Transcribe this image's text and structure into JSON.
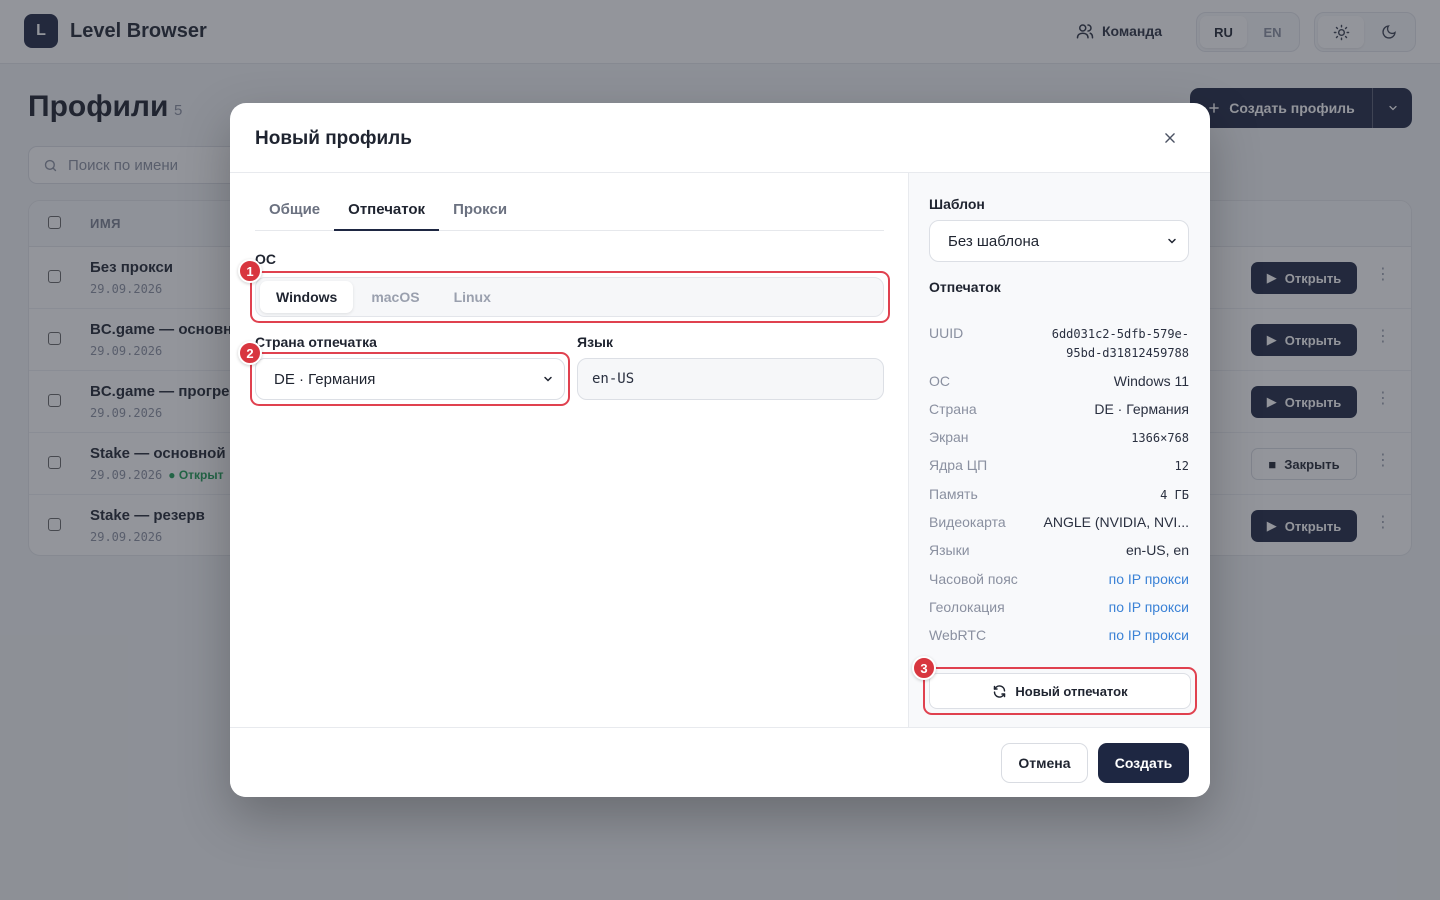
{
  "app": {
    "logo_letter": "L",
    "name": "Level Browser"
  },
  "header": {
    "team_label": "Команда",
    "languages": [
      "RU",
      "EN"
    ],
    "active_language": "RU"
  },
  "page": {
    "title": "Профили",
    "count": "5",
    "create_label": "Создать профиль",
    "search_placeholder": "Поиск по имени",
    "column_name": "ИМЯ"
  },
  "profiles": [
    {
      "name": "Без прокси",
      "date": "29.09.2026",
      "status": "",
      "action": "Открыть"
    },
    {
      "name": "BC.game — основной",
      "date": "29.09.2026",
      "status": "",
      "action": "Открыть"
    },
    {
      "name": "BC.game — прогрев",
      "date": "29.09.2026",
      "status": "",
      "action": "Открыть"
    },
    {
      "name": "Stake — основной",
      "date": "29.09.2026",
      "status": "● Открыт",
      "action": "Закрыть"
    },
    {
      "name": "Stake — резерв",
      "date": "29.09.2026",
      "status": "",
      "action": "Открыть"
    }
  ],
  "modal": {
    "title": "Новый профиль",
    "tabs": [
      "Общие",
      "Отпечаток",
      "Прокси"
    ],
    "active_tab": "Отпечаток",
    "os_label": "ОС",
    "os_options": [
      "Windows",
      "macOS",
      "Linux"
    ],
    "os_selected": "Windows",
    "country_label": "Страна отпечатка",
    "country_value": "DE · Германия",
    "language_label": "Язык",
    "language_value": "en-US",
    "template_label": "Шаблон",
    "template_value": "Без шаблона",
    "fingerprint_label": "Отпечаток",
    "fingerprint": {
      "uuid_key": "UUID",
      "uuid_line1": "6dd031c2-5dfb-579e-",
      "uuid_line2": "95bd-d31812459788",
      "os_key": "ОС",
      "os_val": "Windows 11",
      "country_key": "Страна",
      "country_val": "DE · Германия",
      "screen_key": "Экран",
      "screen_val": "1366×768",
      "cores_key": "Ядра ЦП",
      "cores_val": "12",
      "memory_key": "Память",
      "memory_val": "4 ГБ",
      "gpu_key": "Видеокарта",
      "gpu_val": "ANGLE (NVIDIA, NVI...",
      "langs_key": "Языки",
      "langs_val": "en-US, en",
      "tz_key": "Часовой пояс",
      "tz_val": "по IP прокси",
      "geo_key": "Геолокация",
      "geo_val": "по IP прокси",
      "webrtc_key": "WebRTC",
      "webrtc_val": "по IP прокси"
    },
    "new_fingerprint_label": "Новый отпечаток",
    "cancel_label": "Отмена",
    "submit_label": "Создать"
  },
  "annotations": [
    "1",
    "2",
    "3"
  ],
  "colors": {
    "primary": "#1e2742",
    "highlight": "#e0414f",
    "link": "#3b82d6",
    "status_open": "#1f9d55"
  }
}
